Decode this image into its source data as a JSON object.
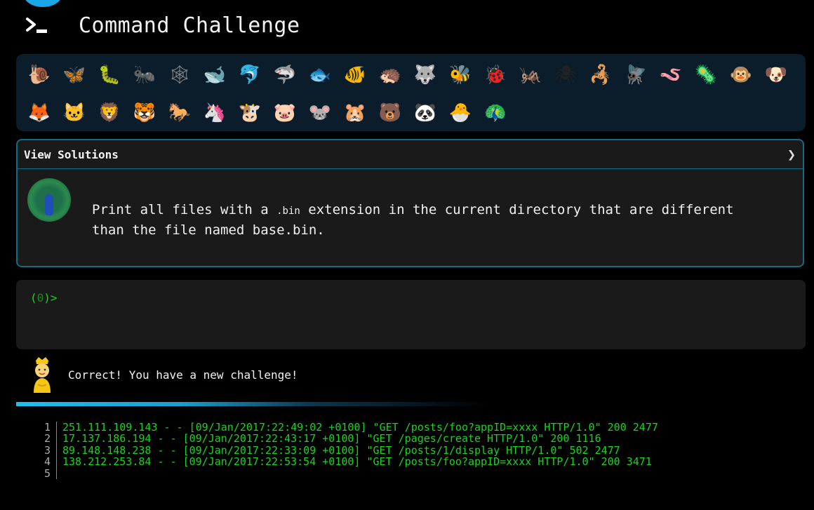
{
  "app": {
    "title": "Command Challenge",
    "icon": "terminal-prompt-icon",
    "accent": "#1aa7e6"
  },
  "emoji_panel": {
    "rows": [
      [
        {
          "name": "snail",
          "glyph": "🐌",
          "color": "#7a6a3a"
        },
        {
          "name": "butterfly",
          "glyph": "🦋",
          "color": "#e79a3a"
        },
        {
          "name": "bug",
          "glyph": "🐛",
          "color": "#7cc142"
        },
        {
          "name": "ant",
          "glyph": "🐜",
          "color": "#4a2a1a"
        },
        {
          "name": "spider-web",
          "glyph": "🕸",
          "color": "#888888"
        },
        {
          "name": "whale",
          "glyph": "🐋",
          "color": "#3a88c8"
        },
        {
          "name": "dolphin",
          "glyph": "🐬",
          "color": "#3a8ac8"
        },
        {
          "name": "shark",
          "glyph": "🦈",
          "color": "#8aa0b0"
        },
        {
          "name": "fish",
          "glyph": "🐟",
          "color": "#5aa0e0"
        },
        {
          "name": "tropical-fish",
          "glyph": "🐠",
          "color": "#e0c020"
        },
        {
          "name": "hedgehog",
          "glyph": "🦔",
          "color": "#7a5a30"
        },
        {
          "name": "wolf",
          "glyph": "🐺",
          "color": "#8a8a8a"
        },
        {
          "name": "bee",
          "glyph": "🐝",
          "color": "#e0c040"
        },
        {
          "name": "lady-beetle",
          "glyph": "🐞",
          "color": "#d02020"
        },
        {
          "name": "cricket",
          "glyph": "🦗",
          "color": "#5a9a2a"
        },
        {
          "name": "spider",
          "glyph": "🕷",
          "color": "#222222"
        },
        {
          "name": "scorpion",
          "glyph": "🦂",
          "color": "#c03020"
        },
        {
          "name": "fly",
          "glyph": "🪰",
          "color": "#555555"
        },
        {
          "name": "worm",
          "glyph": "🪱",
          "color": "#e07090"
        },
        {
          "name": "microbe",
          "glyph": "🦠",
          "color": "#5a90c8"
        },
        {
          "name": "monkey-face",
          "glyph": "🐵",
          "color": "#8a5a30"
        },
        {
          "name": "dog-face",
          "glyph": "🐶",
          "color": "#d09040"
        }
      ],
      [
        {
          "name": "fox",
          "glyph": "🦊",
          "color": "#e06020"
        },
        {
          "name": "cat-face",
          "glyph": "🐱",
          "color": "#e0a040"
        },
        {
          "name": "lion",
          "glyph": "🦁",
          "color": "#d0a040"
        },
        {
          "name": "tiger-face",
          "glyph": "🐯",
          "color": "#e08020"
        },
        {
          "name": "horse",
          "glyph": "🐎",
          "color": "#8a5a2a"
        },
        {
          "name": "unicorn",
          "glyph": "🦄",
          "color": "#e0e0f0"
        },
        {
          "name": "cow-face",
          "glyph": "🐮",
          "color": "#e0e0e0"
        },
        {
          "name": "pig-face",
          "glyph": "🐷",
          "color": "#f0a0b0"
        },
        {
          "name": "mouse-face",
          "glyph": "🐭",
          "color": "#c0c0c0"
        },
        {
          "name": "hamster",
          "glyph": "🐹",
          "color": "#e0a060"
        },
        {
          "name": "bear",
          "glyph": "🐻",
          "color": "#6a3a1a"
        },
        {
          "name": "panda",
          "glyph": "🐼",
          "color": "#f0f0f0"
        },
        {
          "name": "hatching-chick",
          "glyph": "🐣",
          "color": "#f0d040"
        },
        {
          "name": "peacock",
          "glyph": "🦚",
          "color": "#2a8a4a"
        }
      ]
    ]
  },
  "solutions": {
    "title": "View Solutions",
    "chevron": "❯"
  },
  "task": {
    "before": "Print all files with a ",
    "code": ".bin",
    "after": " extension in the current directory that are different than the file named base.bin."
  },
  "terminal": {
    "prompt_open": "(",
    "prompt_code": "0",
    "prompt_close": ")>"
  },
  "status": {
    "message": "Correct! You have a new challenge!"
  },
  "progress": {
    "fraction": 0.6
  },
  "file_lines": [
    {
      "n": "1",
      "text": "251.111.109.143 - - [09/Jan/2017:22:49:02 +0100] \"GET /posts/foo?appID=xxxx HTTP/1.0\" 200 2477"
    },
    {
      "n": "2",
      "text": "17.137.186.194 - - [09/Jan/2017:22:43:17 +0100] \"GET /pages/create HTTP/1.0\" 200 1116"
    },
    {
      "n": "3",
      "text": "89.148.148.238 - - [09/Jan/2017:22:33:09 +0100] \"GET /posts/1/display HTTP/1.0\" 502 2477"
    },
    {
      "n": "4",
      "text": "138.212.253.84 - - [09/Jan/2017:22:53:54 +0100] \"GET /posts/foo?appID=xxxx HTTP/1.0\" 200 3471"
    },
    {
      "n": "5",
      "text": ""
    }
  ]
}
